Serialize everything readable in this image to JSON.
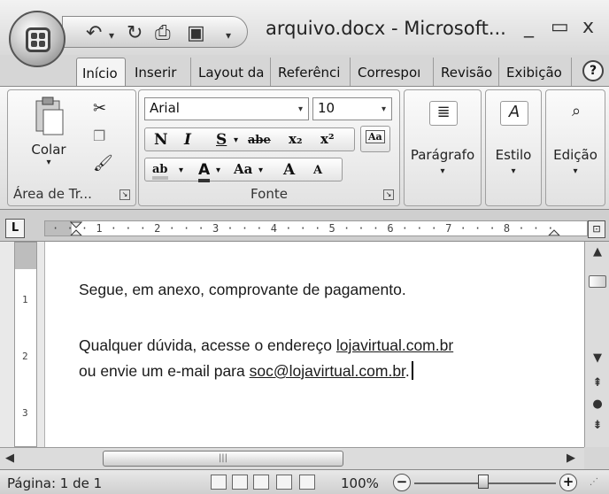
{
  "window": {
    "title": "arquivo.docx - Microsoft...",
    "controls": {
      "minimize": "_",
      "maximize": "▭",
      "close": "x"
    }
  },
  "quick_access": {
    "items": [
      {
        "icon": "undo-icon",
        "glyph": "↶"
      },
      {
        "icon": "dropdown-arrow-icon",
        "glyph": "▾"
      },
      {
        "icon": "redo-icon",
        "glyph": "↻"
      },
      {
        "icon": "print-icon",
        "glyph": "⎙"
      },
      {
        "icon": "save-icon",
        "glyph": "▣"
      },
      {
        "icon": "customize-qat-icon",
        "glyph": "▾"
      }
    ]
  },
  "tabs": [
    {
      "label": "Início",
      "active": true
    },
    {
      "label": "Inserir"
    },
    {
      "label": "Layout da"
    },
    {
      "label": "Referênci"
    },
    {
      "label": "Correspoı"
    },
    {
      "label": "Revisão"
    },
    {
      "label": "Exibição"
    }
  ],
  "help_glyph": "?",
  "ribbon": {
    "clipboard": {
      "paste_label": "Colar",
      "group_label": "Área de Tr...",
      "icons": [
        "paste-icon",
        "cut-icon",
        "copy-icon",
        "format-painter-icon"
      ]
    },
    "font": {
      "group_label": "Fonte",
      "font_name": "Arial",
      "font_size": "10",
      "bold": "N",
      "italic": "I",
      "underline": "S",
      "strike": "abe",
      "subscript": "x₂",
      "superscript": "x²",
      "clear_format": "Aa",
      "highlight": "ab",
      "font_color": "A",
      "change_case": "Aa",
      "grow": "A",
      "shrink": "A"
    },
    "paragraph": {
      "label": "Parágrafo"
    },
    "style": {
      "label": "Estilo"
    },
    "editing": {
      "label": "Edição"
    }
  },
  "ruler": {
    "tab_selector": "L",
    "marks": "· · · 1 · · · 2 · · · 3 · · · 4 · · · 5 · · · 6 · · · 7 · · · 8 · · ·",
    "vertical_marks": [
      "1",
      "2",
      "3"
    ]
  },
  "document": {
    "line1": "Segue, em anexo, comprovante de pagamento.",
    "line2_prefix": "Qualquer dúvida, acesse o endereço",
    "line2_link": "lojavirtual.com.br",
    "line3_prefix": "ou envie um e-mail para",
    "line3_link": "soc@lojavirtual.com.br",
    "line3_suffix": "."
  },
  "status_bar": {
    "page_info": "Página: 1 de 1",
    "zoom": "100%",
    "zoom_fraction": 0.5
  },
  "colors": {
    "chrome": "#d6d6d6",
    "page": "#ffffff",
    "text": "#1a1a1a"
  }
}
